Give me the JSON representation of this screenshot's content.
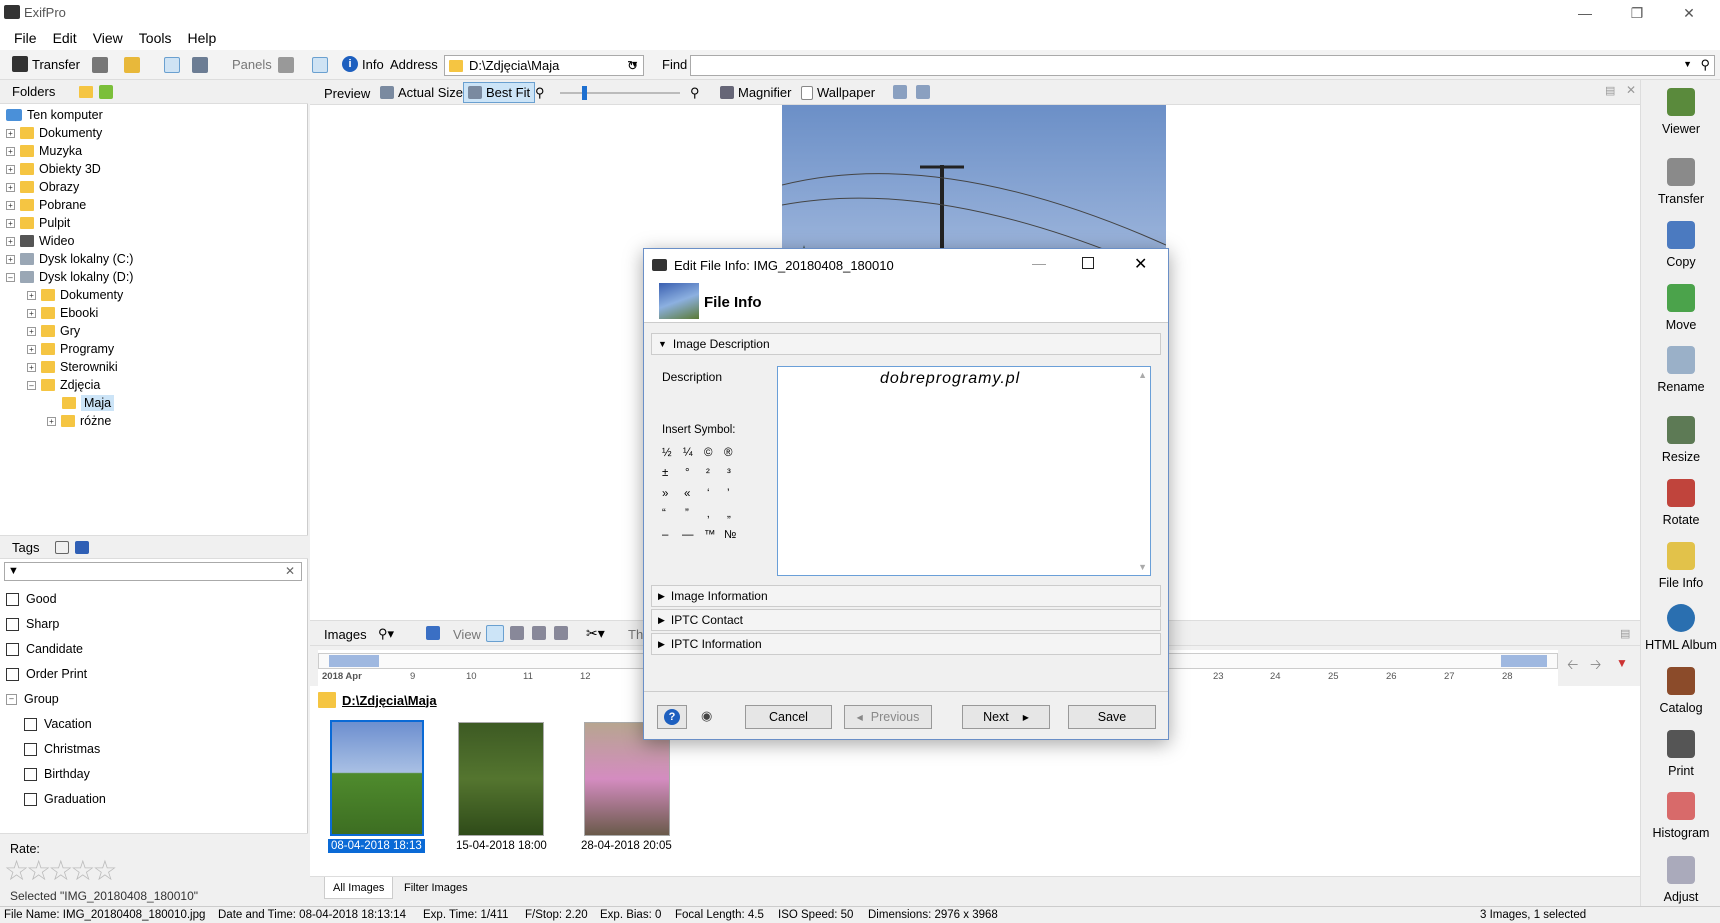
{
  "app": {
    "title": "ExifPro"
  },
  "menu": [
    "File",
    "Edit",
    "View",
    "Tools",
    "Help"
  ],
  "toolbar": {
    "transfer": "Transfer",
    "panels": "Panels",
    "info": "Info",
    "address_label": "Address",
    "address_value": "D:\\Zdjęcia\\Maja",
    "find_label": "Find"
  },
  "folders": {
    "title": "Folders",
    "items": [
      {
        "label": "Ten komputer"
      },
      {
        "label": "Dokumenty"
      },
      {
        "label": "Muzyka"
      },
      {
        "label": "Obiekty 3D"
      },
      {
        "label": "Obrazy"
      },
      {
        "label": "Pobrane"
      },
      {
        "label": "Pulpit"
      },
      {
        "label": "Wideo"
      },
      {
        "label": "Dysk lokalny (C:)"
      },
      {
        "label": "Dysk lokalny (D:)"
      },
      {
        "label": "Dokumenty"
      },
      {
        "label": "Ebooki"
      },
      {
        "label": "Gry"
      },
      {
        "label": "Programy"
      },
      {
        "label": "Sterowniki"
      },
      {
        "label": "Zdjęcia"
      },
      {
        "label": "Maja"
      },
      {
        "label": "różne"
      }
    ]
  },
  "tags": {
    "title": "Tags",
    "items": [
      "Good",
      "Sharp",
      "Candidate",
      "Order Print"
    ],
    "group": "Group",
    "group_items": [
      "Vacation",
      "Christmas",
      "Birthday",
      "Graduation"
    ],
    "rate_label": "Rate:",
    "selected": "Selected \"IMG_20180408_180010\""
  },
  "preview": {
    "preview": "Preview",
    "actual": "Actual Size",
    "bestfit": "Best Fit",
    "magnifier": "Magnifier",
    "wallpaper": "Wallpaper"
  },
  "images_bar": {
    "images": "Images",
    "view": "View",
    "th": "Th"
  },
  "timeline": {
    "start": "2018 Apr",
    "ticks": [
      "9",
      "10",
      "11",
      "12",
      "23",
      "24",
      "25",
      "26",
      "27",
      "28"
    ]
  },
  "thumbs": {
    "folder": "D:\\Zdjęcia\\Maja",
    "items": [
      {
        "label": "08-04-2018  18:13",
        "selected": true
      },
      {
        "label": "15-04-2018  18:00",
        "selected": false
      },
      {
        "label": "28-04-2018  20:05",
        "selected": false
      }
    ]
  },
  "tabs": [
    "All Images",
    "Filter Images"
  ],
  "rightbar": [
    "Viewer",
    "Transfer",
    "Copy",
    "Move",
    "Rename",
    "Resize",
    "Rotate",
    "File Info",
    "HTML Album",
    "Catalog",
    "Print",
    "Histogram",
    "Adjust"
  ],
  "status": {
    "filename": "File Name: IMG_20180408_180010.jpg",
    "datetime": "Date and Time: 08-04-2018  18:13:14",
    "exp": "Exp. Time: 1/411",
    "fstop": "F/Stop: 2.20",
    "bias": "Exp. Bias: 0",
    "focal": "Focal Length: 4.5",
    "iso": "ISO Speed: 50",
    "dims": "Dimensions: 2976 x 3968",
    "count": "3 Images, 1 selected"
  },
  "dialog": {
    "title": "Edit File Info: IMG_20180408_180010",
    "header": "File Info",
    "section_desc": "Image Description",
    "desc_label": "Description",
    "desc_value": "dobreprogramy.pl",
    "insert_symbol": "Insert Symbol:",
    "symbols": [
      [
        "½",
        "¼",
        "©",
        "®"
      ],
      [
        "±",
        "°",
        "²",
        "³"
      ],
      [
        "»",
        "«",
        "‘",
        "’"
      ],
      [
        "“",
        "”",
        "‚",
        "„"
      ],
      [
        "–",
        "—",
        "™",
        "№"
      ]
    ],
    "section_info": "Image Information",
    "section_contact": "IPTC Contact",
    "section_iptc": "IPTC Information",
    "cancel": "Cancel",
    "previous": "Previous",
    "next": "Next",
    "save": "Save"
  },
  "colors": {
    "accent": "#0a6ad6",
    "selected_bg": "#cce4f7",
    "folder": "#f5c542"
  }
}
